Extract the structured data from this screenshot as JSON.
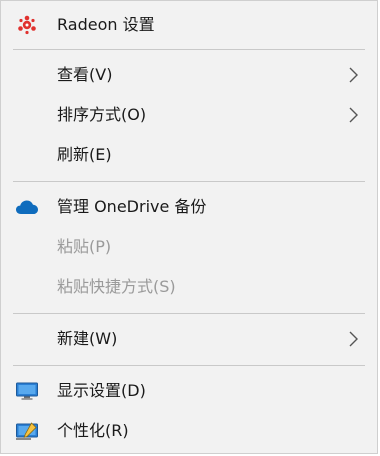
{
  "menu": {
    "items": [
      {
        "label": "Radeon 设置",
        "icon": "radeon-icon"
      },
      {
        "label": "查看(V)",
        "submenu": true
      },
      {
        "label": "排序方式(O)",
        "submenu": true
      },
      {
        "label": "刷新(E)"
      },
      {
        "label": "管理 OneDrive 备份",
        "icon": "onedrive-cloud-icon"
      },
      {
        "label": "粘贴(P)",
        "disabled": true
      },
      {
        "label": "粘贴快捷方式(S)",
        "disabled": true
      },
      {
        "label": "新建(W)",
        "submenu": true
      },
      {
        "label": "显示设置(D)",
        "icon": "display-settings-icon"
      },
      {
        "label": "个性化(R)",
        "icon": "personalize-icon"
      }
    ]
  },
  "colors": {
    "background": "#f2f2f2",
    "separator": "#c9c9c9",
    "text": "#1a1a1a",
    "disabled_text": "#9a9a9a",
    "radeon_red": "#e0322f",
    "onedrive_blue": "#0f6cbd"
  }
}
